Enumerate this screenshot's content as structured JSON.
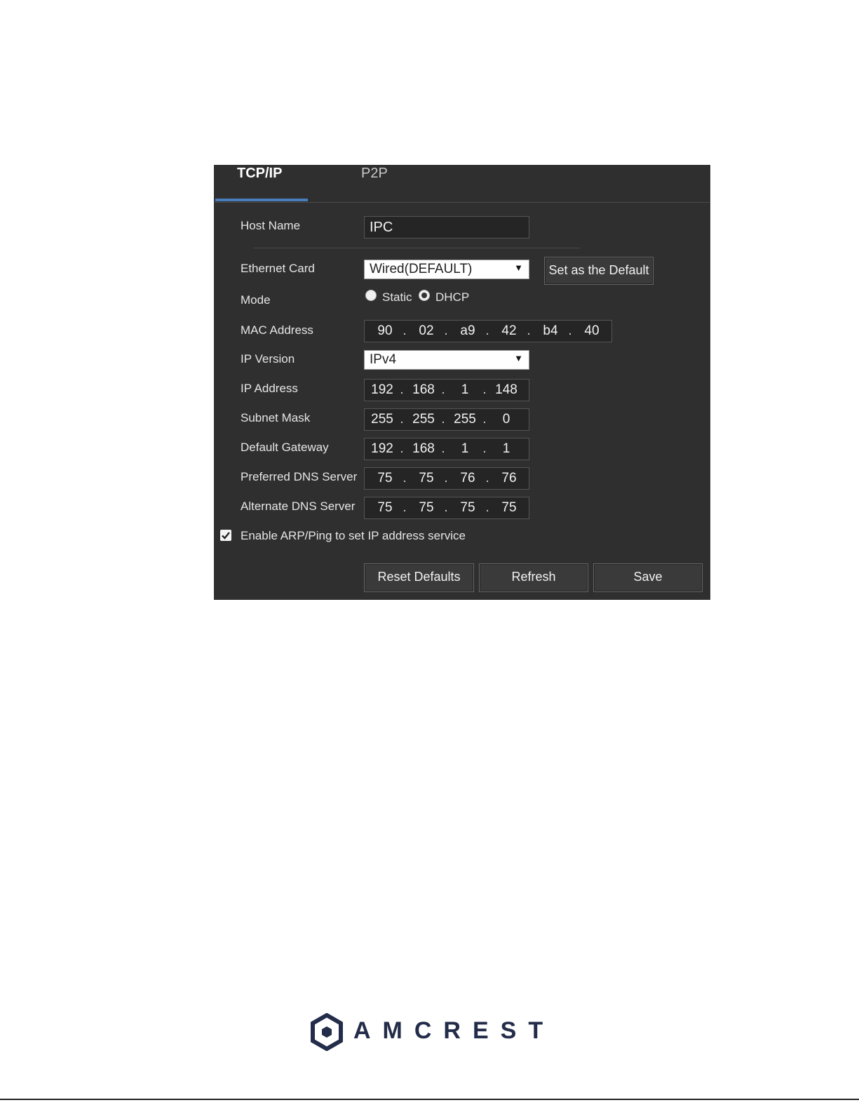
{
  "tabs": [
    {
      "label": "TCP/IP",
      "active": true
    },
    {
      "label": "P2P",
      "active": false
    }
  ],
  "form": {
    "host_name": {
      "label": "Host Name",
      "value": "IPC"
    },
    "ethernet_card": {
      "label": "Ethernet Card",
      "value": "Wired(DEFAULT)",
      "set_default_label": "Set as the Default"
    },
    "mode": {
      "label": "Mode",
      "options": [
        "Static",
        "DHCP"
      ],
      "selected": "DHCP"
    },
    "mac_address": {
      "label": "MAC Address",
      "octets": [
        "90",
        "02",
        "a9",
        "42",
        "b4",
        "40"
      ]
    },
    "ip_version": {
      "label": "IP Version",
      "value": "IPv4"
    },
    "ip_address": {
      "label": "IP Address",
      "octets": [
        "192",
        "168",
        "1",
        "148"
      ]
    },
    "subnet_mask": {
      "label": "Subnet Mask",
      "octets": [
        "255",
        "255",
        "255",
        "0"
      ]
    },
    "default_gateway": {
      "label": "Default Gateway",
      "octets": [
        "192",
        "168",
        "1",
        "1"
      ]
    },
    "preferred_dns": {
      "label": "Preferred DNS Server",
      "octets": [
        "75",
        "75",
        "76",
        "76"
      ]
    },
    "alternate_dns": {
      "label": "Alternate DNS Server",
      "octets": [
        "75",
        "75",
        "75",
        "75"
      ]
    },
    "arp_ping": {
      "label": "Enable ARP/Ping to set IP address service",
      "checked": true
    }
  },
  "buttons": {
    "reset": "Reset Defaults",
    "refresh": "Refresh",
    "save": "Save"
  },
  "brand": {
    "name": "AMCREST",
    "color": "#232c49",
    "icon": "amcrest-hexagon-logo"
  },
  "colors": {
    "panel_bg": "#2f2f2f",
    "tab_accent": "#4a7dbb"
  }
}
